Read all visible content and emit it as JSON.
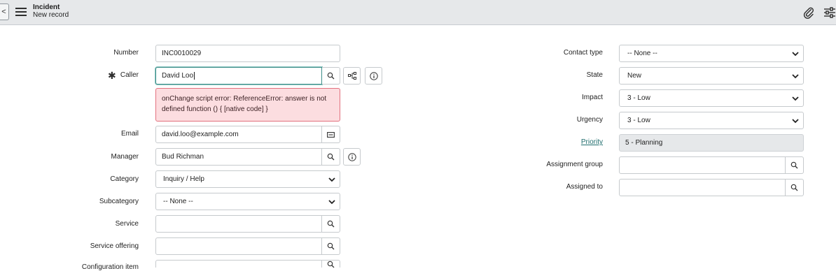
{
  "header": {
    "title": "Incident",
    "subtitle": "New record",
    "back_glyph": "<"
  },
  "left": {
    "number": {
      "label": "Number",
      "value": "INC0010029"
    },
    "caller": {
      "label": "Caller",
      "value": "David Loo",
      "required_mark": "✱",
      "error": "onChange script error: ReferenceError: answer is not defined function () { [native code] }"
    },
    "email": {
      "label": "Email",
      "value": "david.loo@example.com"
    },
    "manager": {
      "label": "Manager",
      "value": "Bud Richman"
    },
    "category": {
      "label": "Category",
      "value": "Inquiry / Help"
    },
    "subcategory": {
      "label": "Subcategory",
      "value": "-- None --"
    },
    "service": {
      "label": "Service",
      "value": ""
    },
    "service_offering": {
      "label": "Service offering",
      "value": ""
    },
    "configuration_item": {
      "label": "Configuration item",
      "value": ""
    }
  },
  "right": {
    "contact_type": {
      "label": "Contact type",
      "value": "-- None --"
    },
    "state": {
      "label": "State",
      "value": "New"
    },
    "impact": {
      "label": "Impact",
      "value": "3 - Low"
    },
    "urgency": {
      "label": "Urgency",
      "value": "3 - Low"
    },
    "priority": {
      "label": "Priority",
      "value": "5 - Planning"
    },
    "assignment_group": {
      "label": "Assignment group",
      "value": ""
    },
    "assigned_to": {
      "label": "Assigned to",
      "value": ""
    }
  },
  "icons": {
    "menu": "menu-icon",
    "attach": "paperclip-icon",
    "settings": "sliders-icon",
    "lookup": "search-icon",
    "tree": "hierarchy-icon",
    "info": "info-icon",
    "email_action": "envelope-icon",
    "dropdown": "chevron-down-icon"
  },
  "colors": {
    "error_bg": "#fcdde0",
    "error_border": "#e3727f",
    "focus": "#3f8f8a",
    "link": "#1f6d6d"
  }
}
